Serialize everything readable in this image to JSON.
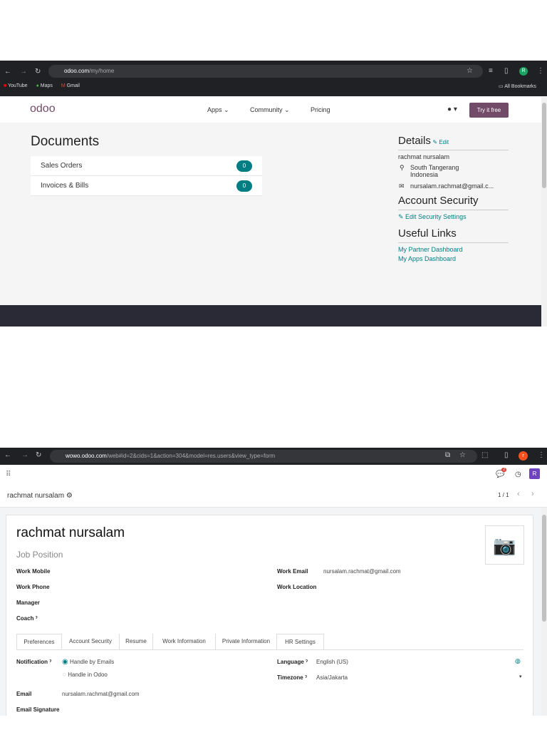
{
  "shot1": {
    "browser": {
      "url_host": "odoo.com",
      "url_path": "/my/home",
      "bookmarks": [
        "YouTube",
        "Maps",
        "Gmail"
      ],
      "all_bookmarks": "All Bookmarks",
      "avatar": "R"
    },
    "nav": {
      "logo": "odoo",
      "items": [
        "Apps",
        "Community",
        "Pricing"
      ],
      "cta": "Try it free"
    },
    "documents": {
      "title": "Documents",
      "rows": [
        {
          "label": "Sales Orders",
          "count": "0"
        },
        {
          "label": "Invoices & Bills",
          "count": "0"
        }
      ]
    },
    "details": {
      "title": "Details",
      "edit": "Edit",
      "name": "rachmat nursalam",
      "city": "South Tangerang",
      "country": "Indonesia",
      "email": "nursalam.rachmat@gmail.c..."
    },
    "security": {
      "title": "Account Security",
      "link": "Edit Security Settings"
    },
    "links": {
      "title": "Useful Links",
      "items": [
        "My Partner Dashboard",
        "My Apps Dashboard"
      ]
    }
  },
  "shot2": {
    "browser": {
      "url_host": "wowo.odoo.com",
      "url_path": "/web#id=2&cids=1&action=304&model=res.users&view_type=form",
      "avatar": "r"
    },
    "nav": {
      "msg_count": "2",
      "avatar": "R"
    },
    "breadcrumb": "rachmat nursalam",
    "pager": "1 / 1",
    "form": {
      "name": "rachmat nursalam",
      "job_position_placeholder": "Job Position",
      "left": [
        "Work Mobile",
        "Work Phone",
        "Manager",
        "Coach"
      ],
      "work_email_label": "Work Email",
      "work_email": "nursalam.rachmat@gmail.com",
      "work_location_label": "Work Location",
      "tabs": [
        "Preferences",
        "Account Security",
        "Resume",
        "Work Information",
        "Private Information",
        "HR Settings"
      ],
      "notification_label": "Notification",
      "notif_options": [
        "Handle by Emails",
        "Handle in Odoo"
      ],
      "language_label": "Language",
      "language": "English (US)",
      "timezone_label": "Timezone",
      "timezone": "Asia/Jakarta",
      "email_label": "Email",
      "email": "nursalam.rachmat@gmail.com",
      "signature_label": "Email Signature"
    }
  }
}
